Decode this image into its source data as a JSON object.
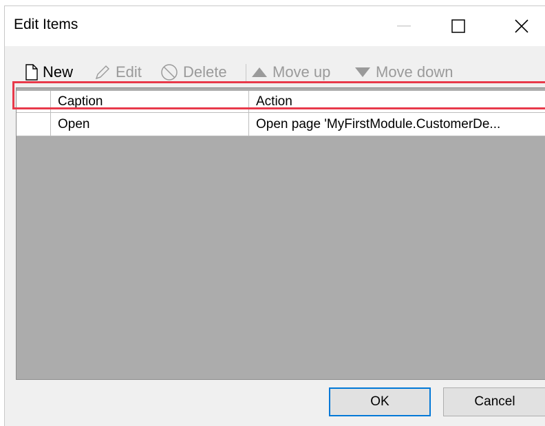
{
  "window": {
    "title": "Edit Items"
  },
  "toolbar": {
    "new_label": "New",
    "edit_label": "Edit",
    "delete_label": "Delete",
    "move_up_label": "Move up",
    "move_down_label": "Move down"
  },
  "grid": {
    "columns": [
      "",
      "Caption",
      "Action"
    ],
    "rows": [
      {
        "caption": "Open",
        "action": "Open page 'MyFirstModule.CustomerDe..."
      }
    ]
  },
  "buttons": {
    "ok": "OK",
    "cancel": "Cancel"
  },
  "colors": {
    "highlight": "#e8394a",
    "accent": "#0078d7",
    "grid_bg": "#acacac"
  }
}
